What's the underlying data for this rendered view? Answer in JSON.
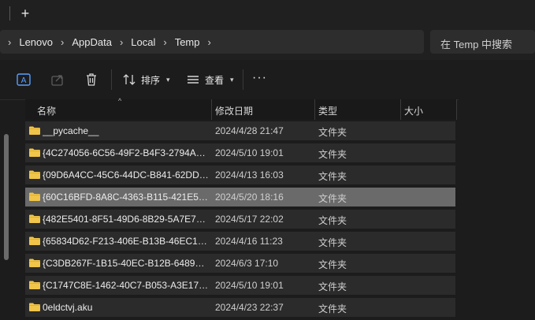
{
  "tabbar": {
    "new_tab_label": "+"
  },
  "breadcrumb": {
    "items": [
      "Lenovo",
      "AppData",
      "Local",
      "Temp"
    ]
  },
  "search": {
    "placeholder": "在 Temp 中搜索"
  },
  "toolbar": {
    "sort_label": "排序",
    "view_label": "查看",
    "more_label": "···"
  },
  "columns": {
    "name": "名称",
    "modified": "修改日期",
    "type": "类型",
    "size": "大小"
  },
  "rows": [
    {
      "name": "__pycache__",
      "modified": "2024/4/28 21:47",
      "type": "文件夹",
      "selected": false
    },
    {
      "name": "{4C274056-6C56-49F2-B4F3-2794A7C...",
      "modified": "2024/5/10 19:01",
      "type": "文件夹",
      "selected": false
    },
    {
      "name": "{09D6A4CC-45C6-44DC-B841-62DDC...",
      "modified": "2024/4/13 16:03",
      "type": "文件夹",
      "selected": false
    },
    {
      "name": "{60C16BFD-8A8C-4363-B115-421E54...",
      "modified": "2024/5/20 18:16",
      "type": "文件夹",
      "selected": true
    },
    {
      "name": "{482E5401-8F51-49D6-8B29-5A7E732...",
      "modified": "2024/5/17 22:02",
      "type": "文件夹",
      "selected": false
    },
    {
      "name": "{65834D62-F213-406E-B13B-46EC17A...",
      "modified": "2024/4/16 11:23",
      "type": "文件夹",
      "selected": false
    },
    {
      "name": "{C3DB267F-1B15-40EC-B12B-6489BE...",
      "modified": "2024/6/3 17:10",
      "type": "文件夹",
      "selected": false
    },
    {
      "name": "{C1747C8E-1462-40C7-B053-A3E1734...",
      "modified": "2024/5/10 19:01",
      "type": "文件夹",
      "selected": false
    },
    {
      "name": "0eldctvj.aku",
      "modified": "2024/4/23 22:37",
      "type": "文件夹",
      "selected": false
    }
  ],
  "colors": {
    "folder": "#f0c54a",
    "selected_row": "#6a6a6a",
    "row_bg": "#2b2b2b",
    "accent_icon": "#5aa0ff"
  }
}
